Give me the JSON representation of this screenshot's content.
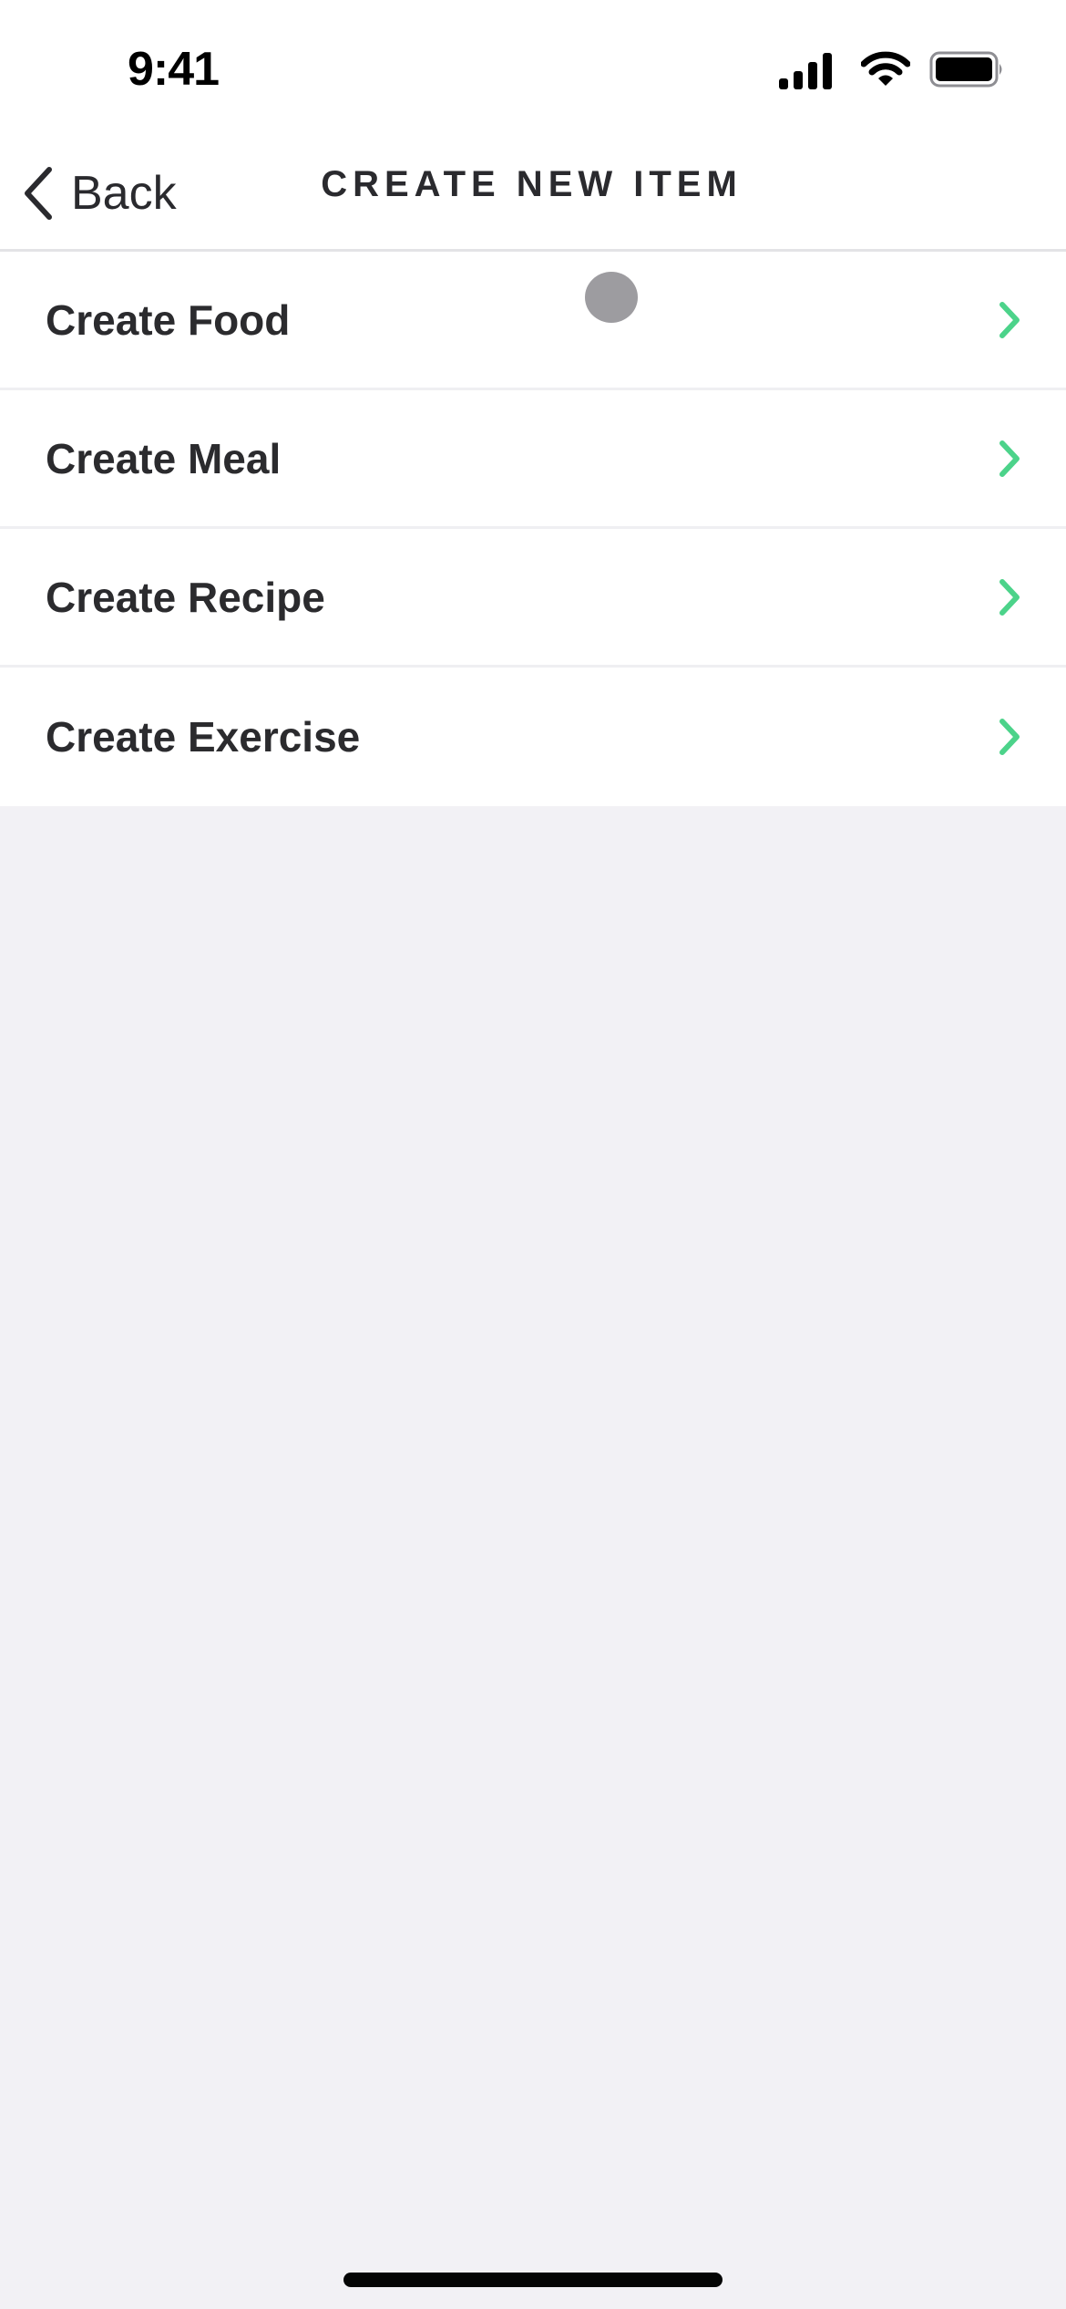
{
  "status_bar": {
    "time": "9:41",
    "icons": [
      "cellular-signal-icon",
      "wifi-icon",
      "battery-icon"
    ]
  },
  "nav": {
    "back_label": "Back",
    "back_icon": "chevron-left-icon",
    "title": "CREATE NEW ITEM"
  },
  "menu": {
    "items": [
      {
        "label": "Create Food",
        "icon": "chevron-right-icon"
      },
      {
        "label": "Create Meal",
        "icon": "chevron-right-icon"
      },
      {
        "label": "Create Recipe",
        "icon": "chevron-right-icon"
      },
      {
        "label": "Create Exercise",
        "icon": "chevron-right-icon"
      }
    ]
  },
  "colors": {
    "accent": "#4cd38a",
    "text": "#2b2b2e",
    "background": "#f2f1f5",
    "row_background": "#ffffff"
  }
}
